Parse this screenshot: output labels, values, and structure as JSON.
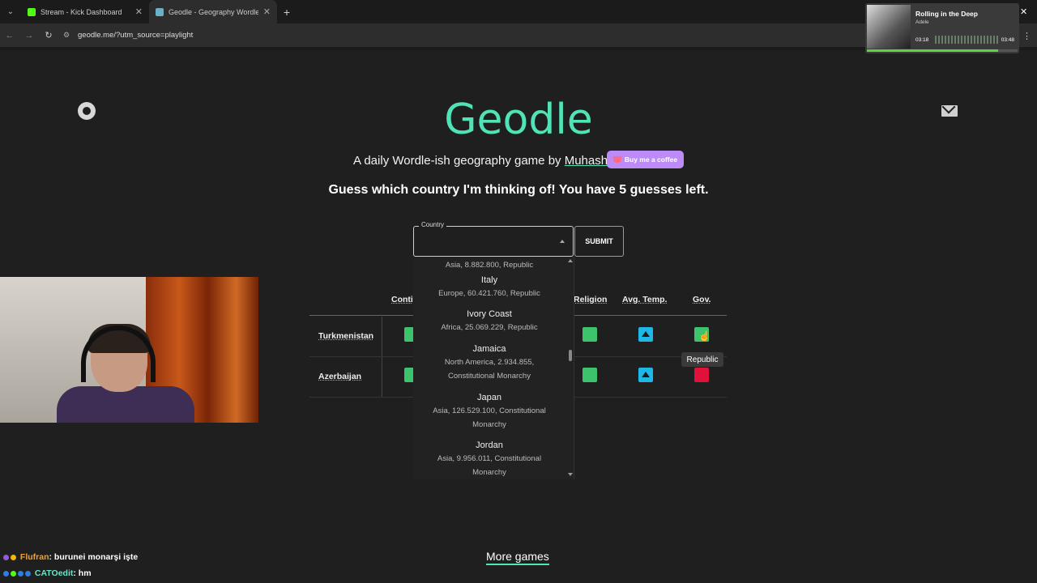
{
  "browser": {
    "tabs": [
      {
        "title": "Stream - Kick Dashboard",
        "favicon_color": "#53fc18",
        "active": false
      },
      {
        "title": "Geodle - Geography Wordle",
        "favicon_color": "#6ab0c8",
        "active": true
      }
    ],
    "url": "geodle.me/?utm_source=playlight"
  },
  "music_widget": {
    "title": "Rolling in the Deep",
    "artist": "Adele",
    "time_elapsed": "03:18",
    "time_total": "03:48",
    "progress": 0.87
  },
  "page": {
    "logo": "Geodle",
    "tagline_prefix": "A daily Wordle-ish geography game by ",
    "author": "Muhashi",
    "coffee_button": "Buy me a coffee",
    "guess_prompt": "Guess which country I'm thinking of! You have 5 guesses left.",
    "country_label": "Country",
    "submit_label": "SUBMIT",
    "more_games": "More games",
    "accent": "#4fe3b6"
  },
  "dropdown": {
    "partial_top": "Asia, 8.882.800, Republic",
    "options": [
      {
        "name": "Italy",
        "details": "Europe, 60.421.760, Republic"
      },
      {
        "name": "Ivory Coast",
        "details": "Africa, 25.069.229, Republic"
      },
      {
        "name": "Jamaica",
        "details": "North America, 2.934.855, Constitutional Monarchy"
      },
      {
        "name": "Japan",
        "details": "Asia, 126.529.100, Constitutional Monarchy"
      },
      {
        "name": "Jordan",
        "details": "Asia, 9.956.011, Constitutional Monarchy"
      }
    ]
  },
  "table": {
    "headers": {
      "continent": "Conti",
      "religion": "Religion",
      "avg_temp": "Avg. Temp.",
      "gov": "Gov."
    },
    "rows": [
      {
        "country": "Turkmenistan",
        "continent": "green",
        "religion": "green",
        "avg_temp": "blue-up",
        "gov": "green"
      },
      {
        "country": "Azerbaijan",
        "continent": "green",
        "religion": "green",
        "avg_temp": "blue-up",
        "gov": "red"
      }
    ],
    "tooltip": "Republic",
    "colors": {
      "green": "#3cc36b",
      "blue": "#1eb8e6",
      "red": "#e0123c"
    }
  },
  "chat": [
    {
      "user": "Flufran",
      "user_color": "#e8a33d",
      "message": ": burunei monarşi işte"
    },
    {
      "user": "CATOedit",
      "user_color": "#6fe3c8",
      "message": ": hm"
    }
  ]
}
